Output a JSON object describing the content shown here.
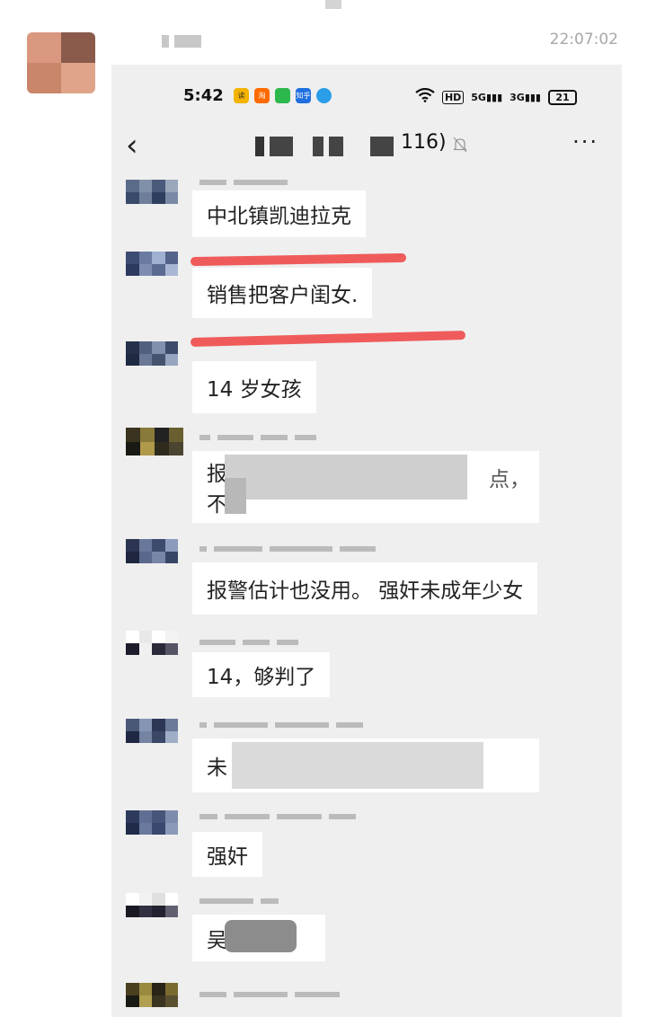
{
  "outer": {
    "timestamp": "22:07:02"
  },
  "screenshot": {
    "status_bar": {
      "time": "5:42",
      "app_icons": [
        "读",
        "淘",
        "",
        "知乎",
        ""
      ],
      "network_badge": "HD",
      "signal_5g": "5G",
      "signal_3g": "3G",
      "battery": "21"
    },
    "chat_header": {
      "member_count": "116)",
      "back_icon": "‹",
      "more_icon": "···"
    },
    "messages": [
      {
        "text": "中北镇凯迪拉克"
      },
      {
        "text": "销售把客户闺女."
      },
      {
        "text": "14 岁女孩"
      },
      {
        "text": "报",
        "text2": "不",
        "tail": "点，"
      },
      {
        "text": "报警估计也没用。 强奸未成年少女"
      },
      {
        "text": "14，够判了"
      },
      {
        "text": "未"
      },
      {
        "text": "强奸"
      },
      {
        "text": "吴"
      }
    ]
  }
}
